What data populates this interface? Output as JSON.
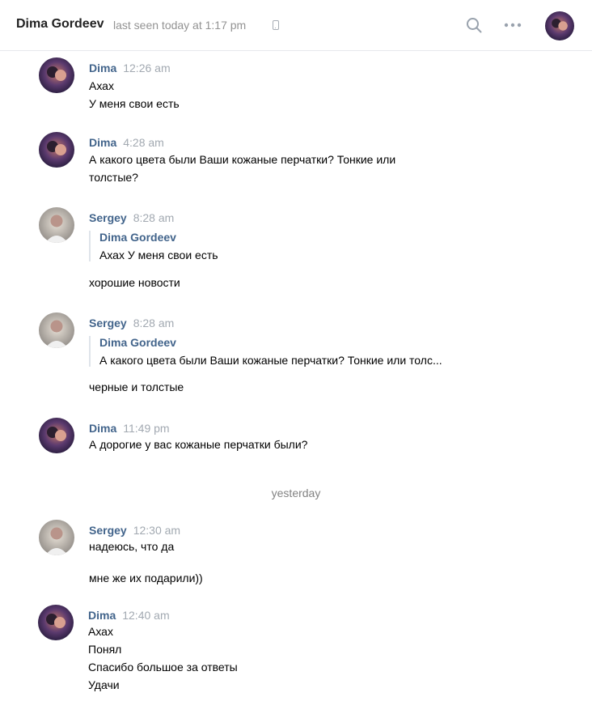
{
  "header": {
    "name": "Dima Gordeev",
    "status": "last seen today at 1:17 pm",
    "icons": [
      "phone-icon",
      "search-icon",
      "more-icon"
    ]
  },
  "messages": [
    {
      "author": "Dima",
      "time": "12:26 am",
      "lines": [
        "Ахах",
        "У меня свои есть"
      ]
    },
    {
      "author": "Dima",
      "time": "4:28 am",
      "lines": [
        "А какого цвета были Ваши кожаные перчатки? Тонкие или",
        "толстые?"
      ]
    },
    {
      "author": "Sergey",
      "time": "8:28 am",
      "quote": {
        "author": "Dima Gordeev",
        "text": "Ахах У меня свои есть"
      },
      "lines": [
        "хорошие новости"
      ]
    },
    {
      "author": "Sergey",
      "time": "8:28 am",
      "quote": {
        "author": "Dima Gordeev",
        "text": "А какого цвета были Ваши кожаные перчатки? Тонкие или толс..."
      },
      "lines": [
        "черные и толстые"
      ]
    },
    {
      "author": "Dima",
      "time": "11:49 pm",
      "lines": [
        "А дорогие у вас кожаные перчатки были?"
      ]
    },
    {
      "author": "Sergey",
      "time": "12:30 am",
      "lines": [
        "надеюсь, что да",
        "мне же их подарили))"
      ]
    },
    {
      "author": "Dima",
      "time": "12:40 am",
      "lines": [
        "Ахах",
        "Понял",
        "Спасибо большое за ответы",
        "Удачи"
      ]
    }
  ],
  "date_separator": "yesterday",
  "colors": {
    "author": "#42648b",
    "time": "#a2a9b1",
    "divider": "#e7e8ec"
  }
}
